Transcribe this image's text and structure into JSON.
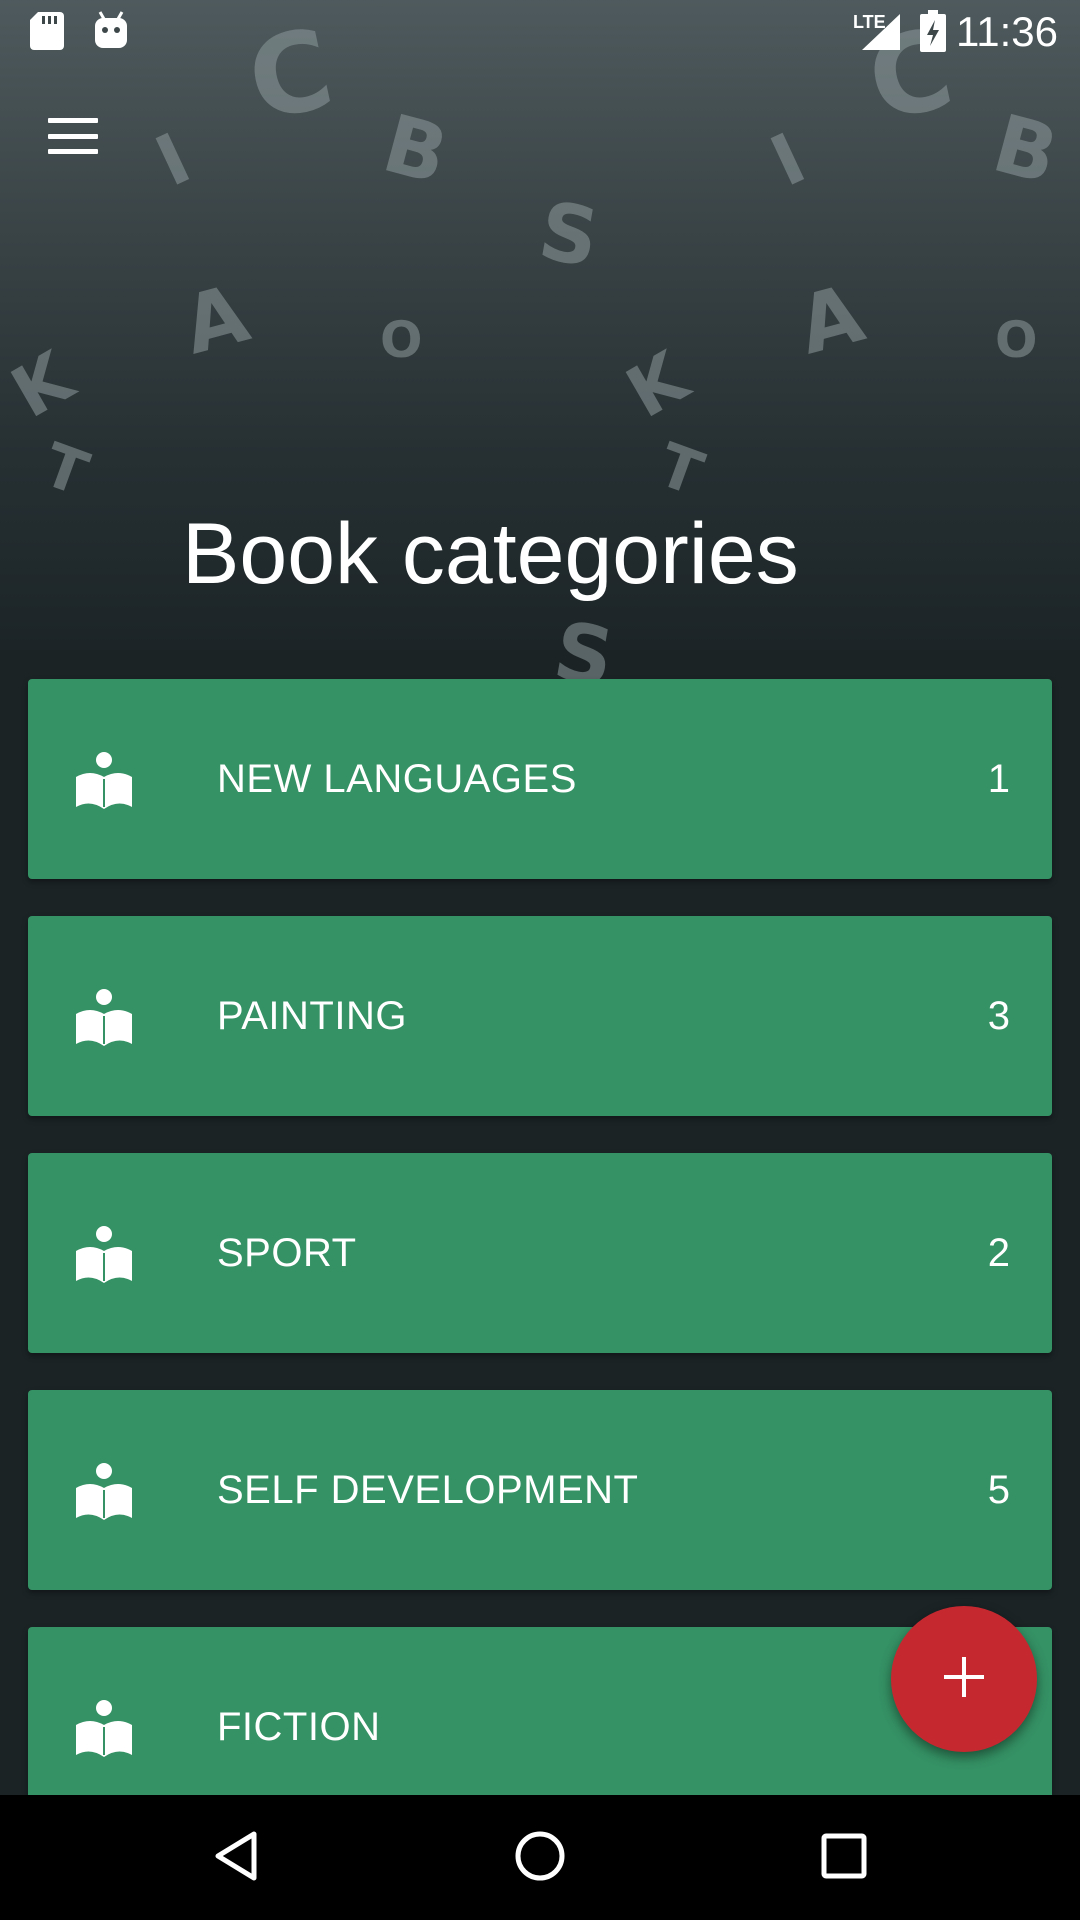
{
  "status_bar": {
    "time": "11:36",
    "network_label": "LTE",
    "icons": [
      "sd-card-icon",
      "android-icon",
      "signal-icon",
      "battery-charging-icon"
    ]
  },
  "header": {
    "title": "Book categories",
    "menu_icon": "menu-icon",
    "background_letters": [
      "C",
      "B",
      "I",
      "S",
      "A",
      "O",
      "K",
      "T",
      "C",
      "B",
      "I",
      "S",
      "A",
      "O",
      "K",
      "T"
    ]
  },
  "categories": [
    {
      "label": "NEW LANGUAGES",
      "count": "1",
      "icon": "book-reader-icon"
    },
    {
      "label": "PAINTING",
      "count": "3",
      "icon": "book-reader-icon"
    },
    {
      "label": "SPORT",
      "count": "2",
      "icon": "book-reader-icon"
    },
    {
      "label": "SELF DEVELOPMENT",
      "count": "5",
      "icon": "book-reader-icon"
    },
    {
      "label": "FICTION",
      "count": "",
      "icon": "book-reader-icon"
    }
  ],
  "fab": {
    "icon": "plus-icon"
  },
  "nav_bar": {
    "icons": [
      "back-icon",
      "home-icon",
      "recents-icon"
    ]
  },
  "colors": {
    "card": "#359265",
    "fab": "#c62830",
    "header_top": "#4e5a5d",
    "background": "#1b2325",
    "nav_bar": "#000000"
  }
}
